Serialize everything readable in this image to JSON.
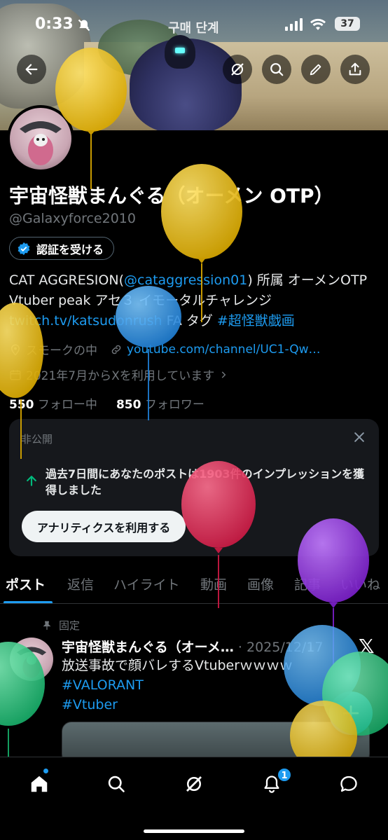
{
  "status_bar": {
    "time": "0:33",
    "battery": "37"
  },
  "banner": {
    "hud_text": "구매 단계"
  },
  "profile": {
    "name": "宇宙怪獣まんぐる（オーメン OTP）",
    "handle": "@Galaxyforce2010",
    "verify_label": "認証を受ける",
    "bio_part1": "CAT AGGRESION(",
    "bio_mention": "@cataggression01",
    "bio_part2": ") 所属 オーメンOTP Vtuber peak アセ３ イモータルチャレンジ ",
    "bio_link": "twitch.tv/katsudonrush",
    "bio_part3": " FA タグ ",
    "bio_hashtag": "#超怪獣戯画",
    "location": "スモークの中",
    "website": "youtube.com/channel/UC1-Qw…",
    "joined": "2021年7月からXを利用しています",
    "following_count": "550",
    "following_label": "フォロー中",
    "followers_count": "850",
    "followers_label": "フォロワー"
  },
  "analytics_card": {
    "private_label": "非公開",
    "message": "過去7日間にあなたのポストは1903件のインプレッションを獲得しました",
    "cta": "アナリティクスを利用する"
  },
  "tabs": [
    "ポスト",
    "返信",
    "ハイライト",
    "動画",
    "画像",
    "記事",
    "いいね"
  ],
  "pinned_post": {
    "pinned_label": "固定",
    "author": "宇宙怪獣まんぐる（オーメ…",
    "date": "· 2025/12/17",
    "text": "放送事故で顔バレするVtuberｗｗｗｗ",
    "hashtag1": "#VALORANT",
    "hashtag2": "#Vtuber"
  },
  "bottom_nav": {
    "notifications_badge": "1"
  },
  "colors": {
    "accent": "#1d9bf0",
    "background": "#000000",
    "muted": "#71767b"
  }
}
